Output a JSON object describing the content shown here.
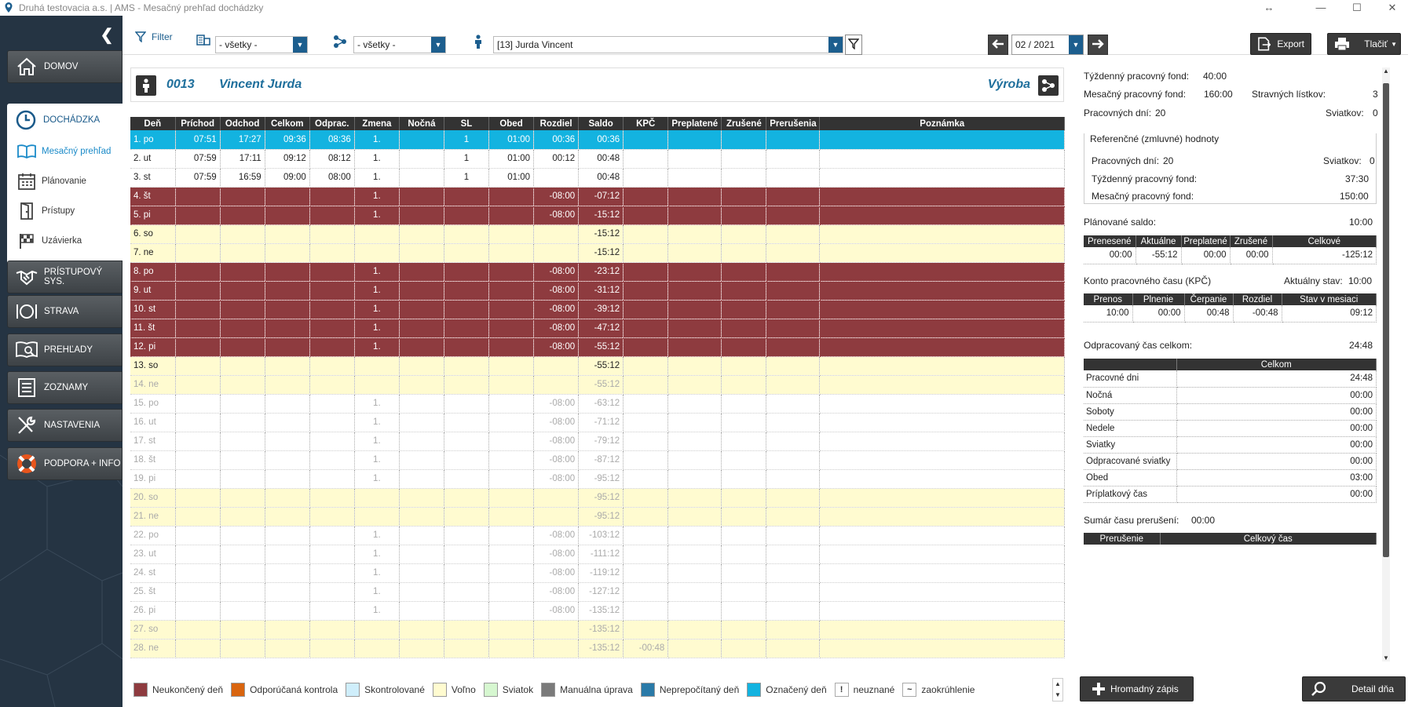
{
  "window": {
    "title": "Druhá testovacia a.s. | AMS - Mesačný prehľad dochádzky"
  },
  "nav": {
    "domov": "DOMOV",
    "dochadzka": "DOCHÁDZKA",
    "sub": [
      "Mesačný prehľad",
      "Plánovanie",
      "Prístupy",
      "Uzávierka"
    ],
    "items": [
      "PRÍSTUPOVÝ SYS.",
      "STRAVA",
      "PREHĽADY",
      "ZOZNAMY",
      "NASTAVENIA",
      "PODPORA + INFO"
    ]
  },
  "toolbar": {
    "filter_label": "Filter",
    "combo1": "- všetky -",
    "combo2": "- všetky -",
    "employee": "[13] Jurda Vincent",
    "period": "02 / 2021",
    "export": "Export",
    "print": "Tlačiť"
  },
  "employee": {
    "number": "0013",
    "name": "Vincent Jurda",
    "department": "Výroba"
  },
  "columns": [
    "Deň",
    "Príchod",
    "Odchod",
    "Celkom",
    "Odprac.",
    "Zmena",
    "Nočná",
    "SL",
    "Obed",
    "Rozdiel",
    "Saldo",
    "KPČ",
    "Preplatené",
    "Zrušené",
    "Prerušenia",
    "Poznámka"
  ],
  "rows": [
    {
      "t": "sel",
      "c": [
        "1. po",
        "07:51",
        "17:27",
        "09:36",
        "08:36",
        "1.",
        "",
        "1",
        "01:00",
        "00:36",
        "00:36",
        "",
        "",
        "",
        "",
        ""
      ]
    },
    {
      "t": "",
      "c": [
        "2. ut",
        "07:59",
        "17:11",
        "09:12",
        "08:12",
        "1.",
        "",
        "1",
        "01:00",
        "00:12",
        "00:48",
        "",
        "",
        "",
        "",
        ""
      ]
    },
    {
      "t": "",
      "c": [
        "3. st",
        "07:59",
        "16:59",
        "09:00",
        "08:00",
        "1.",
        "",
        "1",
        "01:00",
        "",
        "00:48",
        "",
        "",
        "",
        "",
        ""
      ]
    },
    {
      "t": "red",
      "c": [
        "4. št",
        "",
        "",
        "",
        "",
        "1.",
        "",
        "",
        "",
        "-08:00",
        "-07:12",
        "",
        "",
        "",
        "",
        ""
      ]
    },
    {
      "t": "red",
      "c": [
        "5. pi",
        "",
        "",
        "",
        "",
        "1.",
        "",
        "",
        "",
        "-08:00",
        "-15:12",
        "",
        "",
        "",
        "",
        ""
      ]
    },
    {
      "t": "yel",
      "c": [
        "6. so",
        "",
        "",
        "",
        "",
        "",
        "",
        "",
        "",
        "",
        "-15:12",
        "",
        "",
        "",
        "",
        ""
      ]
    },
    {
      "t": "yel",
      "c": [
        "7. ne",
        "",
        "",
        "",
        "",
        "",
        "",
        "",
        "",
        "",
        "-15:12",
        "",
        "",
        "",
        "",
        ""
      ]
    },
    {
      "t": "red",
      "c": [
        "8. po",
        "",
        "",
        "",
        "",
        "1.",
        "",
        "",
        "",
        "-08:00",
        "-23:12",
        "",
        "",
        "",
        "",
        ""
      ]
    },
    {
      "t": "red",
      "c": [
        "9. ut",
        "",
        "",
        "",
        "",
        "1.",
        "",
        "",
        "",
        "-08:00",
        "-31:12",
        "",
        "",
        "",
        "",
        ""
      ]
    },
    {
      "t": "red",
      "c": [
        "10. st",
        "",
        "",
        "",
        "",
        "1.",
        "",
        "",
        "",
        "-08:00",
        "-39:12",
        "",
        "",
        "",
        "",
        ""
      ]
    },
    {
      "t": "red",
      "c": [
        "11. št",
        "",
        "",
        "",
        "",
        "1.",
        "",
        "",
        "",
        "-08:00",
        "-47:12",
        "",
        "",
        "",
        "",
        ""
      ]
    },
    {
      "t": "red",
      "c": [
        "12. pi",
        "",
        "",
        "",
        "",
        "1.",
        "",
        "",
        "",
        "-08:00",
        "-55:12",
        "",
        "",
        "",
        "",
        ""
      ]
    },
    {
      "t": "yel",
      "c": [
        "13. so",
        "",
        "",
        "",
        "",
        "",
        "",
        "",
        "",
        "",
        "-55:12",
        "",
        "",
        "",
        "",
        ""
      ]
    },
    {
      "t": "yel fut",
      "c": [
        "14. ne",
        "",
        "",
        "",
        "",
        "",
        "",
        "",
        "",
        "",
        "-55:12",
        "",
        "",
        "",
        "",
        ""
      ]
    },
    {
      "t": "fut",
      "c": [
        "15. po",
        "",
        "",
        "",
        "",
        "1.",
        "",
        "",
        "",
        "-08:00",
        "-63:12",
        "",
        "",
        "",
        "",
        ""
      ]
    },
    {
      "t": "fut",
      "c": [
        "16. ut",
        "",
        "",
        "",
        "",
        "1.",
        "",
        "",
        "",
        "-08:00",
        "-71:12",
        "",
        "",
        "",
        "",
        ""
      ]
    },
    {
      "t": "fut",
      "c": [
        "17. st",
        "",
        "",
        "",
        "",
        "1.",
        "",
        "",
        "",
        "-08:00",
        "-79:12",
        "",
        "",
        "",
        "",
        ""
      ]
    },
    {
      "t": "fut",
      "c": [
        "18. št",
        "",
        "",
        "",
        "",
        "1.",
        "",
        "",
        "",
        "-08:00",
        "-87:12",
        "",
        "",
        "",
        "",
        ""
      ]
    },
    {
      "t": "fut",
      "c": [
        "19. pi",
        "",
        "",
        "",
        "",
        "1.",
        "",
        "",
        "",
        "-08:00",
        "-95:12",
        "",
        "",
        "",
        "",
        ""
      ]
    },
    {
      "t": "yel fut",
      "c": [
        "20. so",
        "",
        "",
        "",
        "",
        "",
        "",
        "",
        "",
        "",
        "-95:12",
        "",
        "",
        "",
        "",
        ""
      ]
    },
    {
      "t": "yel fut",
      "c": [
        "21. ne",
        "",
        "",
        "",
        "",
        "",
        "",
        "",
        "",
        "",
        "-95:12",
        "",
        "",
        "",
        "",
        ""
      ]
    },
    {
      "t": "fut",
      "c": [
        "22. po",
        "",
        "",
        "",
        "",
        "1.",
        "",
        "",
        "",
        "-08:00",
        "-103:12",
        "",
        "",
        "",
        "",
        ""
      ]
    },
    {
      "t": "fut",
      "c": [
        "23. ut",
        "",
        "",
        "",
        "",
        "1.",
        "",
        "",
        "",
        "-08:00",
        "-111:12",
        "",
        "",
        "",
        "",
        ""
      ]
    },
    {
      "t": "fut",
      "c": [
        "24. st",
        "",
        "",
        "",
        "",
        "1.",
        "",
        "",
        "",
        "-08:00",
        "-119:12",
        "",
        "",
        "",
        "",
        ""
      ]
    },
    {
      "t": "fut",
      "c": [
        "25. št",
        "",
        "",
        "",
        "",
        "1.",
        "",
        "",
        "",
        "-08:00",
        "-127:12",
        "",
        "",
        "",
        "",
        ""
      ]
    },
    {
      "t": "fut",
      "c": [
        "26. pi",
        "",
        "",
        "",
        "",
        "1.",
        "",
        "",
        "",
        "-08:00",
        "-135:12",
        "",
        "",
        "",
        "",
        ""
      ]
    },
    {
      "t": "yel fut",
      "c": [
        "27. so",
        "",
        "",
        "",
        "",
        "",
        "",
        "",
        "",
        "",
        "-135:12",
        "",
        "",
        "",
        "",
        ""
      ]
    },
    {
      "t": "yel fut",
      "c": [
        "28. ne",
        "",
        "",
        "",
        "",
        "",
        "",
        "",
        "",
        "",
        "-135:12",
        "-00:48",
        "",
        "",
        "",
        ""
      ]
    }
  ],
  "summary": {
    "weekly_fund_label": "Týždenný pracovný fond:",
    "weekly_fund": "40:00",
    "monthly_fund_label": "Mesačný pracovný fond:",
    "monthly_fund": "160:00",
    "meal_label": "Stravných lístkov:",
    "meal": "3",
    "workdays_label": "Pracovných dní:",
    "workdays": "20",
    "holidays_label": "Sviatkov:",
    "holidays": "0",
    "ref_title": "Referenčné (zmluvné) hodnoty",
    "ref_workdays_label": "Pracovných dní:",
    "ref_workdays": "20",
    "ref_holidays_label": "Sviatkov:",
    "ref_holidays": "0",
    "ref_weekly_label": "Týždenný pracovný fond:",
    "ref_weekly": "37:30",
    "ref_monthly_label": "Mesačný pracovný fond:",
    "ref_monthly": "150:00",
    "planned_label": "Plánované saldo:",
    "planned": "10:00",
    "saldo_cols": [
      "Prenesené",
      "Aktuálne",
      "Preplatené",
      "Zrušené",
      "Celkové"
    ],
    "saldo_vals": [
      "00:00",
      "-55:12",
      "00:00",
      "00:00",
      "-125:12"
    ],
    "kpc_label": "Konto pracovného času (KPČ)",
    "kpc_state_label": "Aktuálny stav:",
    "kpc_state": "10:00",
    "kpc_cols": [
      "Prenos",
      "Plnenie",
      "Čerpanie",
      "Rozdiel",
      "Stav v mesiaci"
    ],
    "kpc_vals": [
      "10:00",
      "00:00",
      "00:48",
      "-00:48",
      "09:12"
    ],
    "worked_label": "Odpracovaný čas celkom:",
    "worked": "24:48",
    "worked_col": "Celkom",
    "worked_rows": [
      [
        "Pracovné dni",
        "24:48"
      ],
      [
        "Nočná",
        "00:00"
      ],
      [
        "Soboty",
        "00:00"
      ],
      [
        "Nedele",
        "00:00"
      ],
      [
        "Sviatky",
        "00:00"
      ],
      [
        "Odpracované sviatky",
        "00:00"
      ],
      [
        "Obed",
        "03:00"
      ],
      [
        "Príplatkový čas",
        "00:00"
      ]
    ],
    "break_label": "Sumár času prerušení:",
    "break_total": "00:00",
    "break_cols": [
      "Prerušenie",
      "Celkový čas"
    ]
  },
  "legend": [
    {
      "label": "Neukončený deň",
      "color": "#8e3b3f"
    },
    {
      "label": "Odporúčaná kontrola",
      "color": "#d9650f"
    },
    {
      "label": "Skontrolované",
      "color": "#cfeefb"
    },
    {
      "label": "Voľno",
      "color": "#fffbd0"
    },
    {
      "label": "Sviatok",
      "color": "#d6f7d0"
    },
    {
      "label": "Manuálna úprava",
      "color": "#7a7a7a"
    },
    {
      "label": "Neprepočítaný deň",
      "color": "#2a7aa8"
    },
    {
      "label": "Označený deň",
      "color": "#13b3e0"
    }
  ],
  "legend_marks": [
    {
      "sym": "!",
      "label": "neuznané"
    },
    {
      "sym": "~",
      "label": "zaokrúhlenie"
    }
  ],
  "actions": {
    "bulk": "Hromadný zápis",
    "detail": "Detail dňa"
  }
}
